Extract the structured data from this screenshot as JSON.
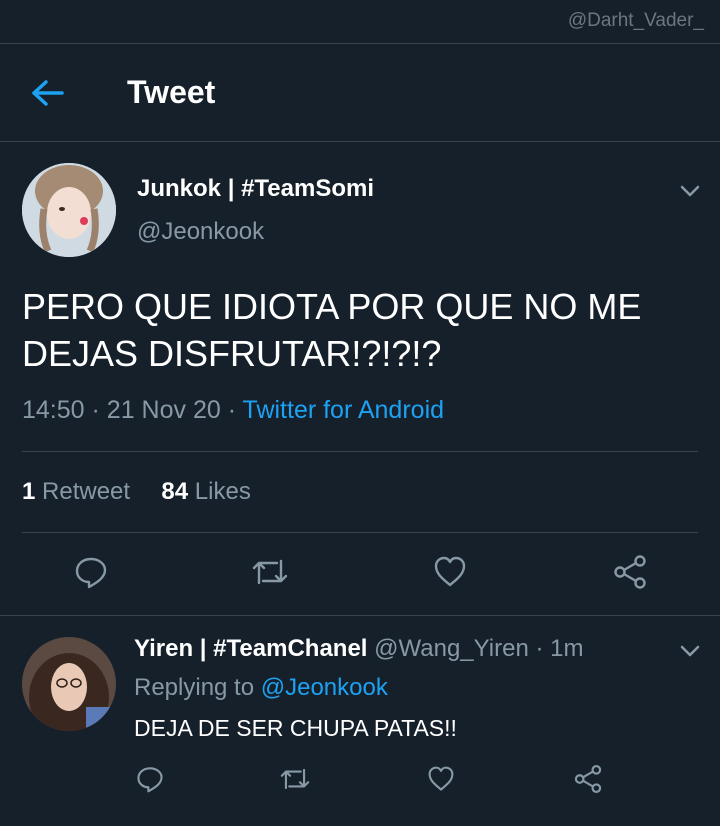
{
  "watermark": "@Darht_Vader_",
  "header": {
    "title": "Tweet",
    "back_icon": "arrow-left-icon"
  },
  "tweet": {
    "author_name": "Junkok | #TeamSomi",
    "author_handle": "@Jeonkook",
    "text": "PERO QUE IDIOTA POR QUE NO ME DEJAS DISFRUTAR!?!?!?",
    "time": "14:50",
    "date": "21 Nov 20",
    "source": "Twitter for Android",
    "retweets_count": "1",
    "retweets_label": "Retweet",
    "likes_count": "84",
    "likes_label": "Likes"
  },
  "reply": {
    "author_name": "Yiren | #TeamChanel",
    "author_handle": "@Wang_Yiren",
    "time_ago": "1m",
    "replying_label": "Replying to",
    "replying_handle": "@Jeonkook",
    "text": "DEJA DE SER CHUPA PATAS!!"
  },
  "colors": {
    "background": "#15202b",
    "accent": "#1da1f2",
    "muted": "#8899a6",
    "border": "#38444d"
  }
}
